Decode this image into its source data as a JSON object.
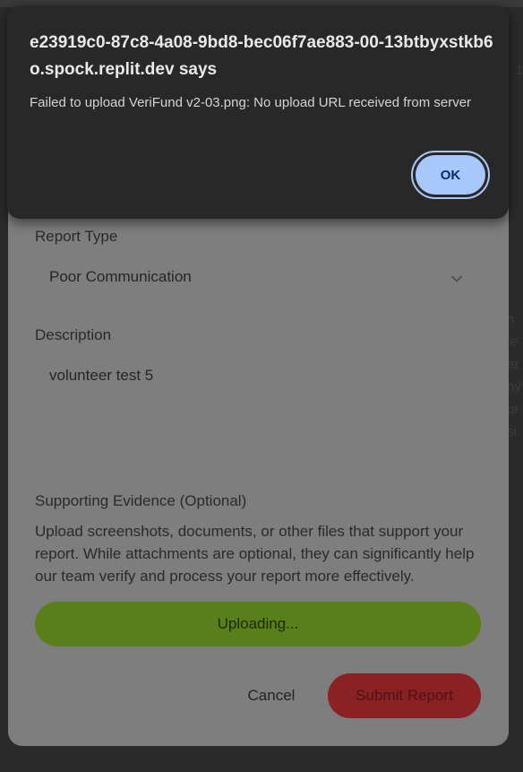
{
  "alert": {
    "title": "e23919c0-87c8-4a08-9bd8-bec06f7ae883-00-13btbyxstkb6o.spock.replit.dev says",
    "message": "Failed to upload VeriFund v2-03.png: No upload URL received from server",
    "ok_label": "OK"
  },
  "form": {
    "report_type_label": "Report Type",
    "report_type_value": "Poor Communication",
    "description_label": "Description",
    "description_value": "volunteer test 5",
    "evidence_label": "Supporting Evidence (Optional)",
    "evidence_help": "Upload screenshots, documents, or other files that support your report. While attachments are optional, they can significantly help our team verify and process your report more effectively.",
    "upload_label": "Uploading...",
    "cancel_label": "Cancel",
    "submit_label": "Submit Report"
  },
  "colors": {
    "upload_button": "#587f1a",
    "submit_button": "#8a2125",
    "ok_button": "#a8c7fa"
  },
  "icons": {
    "select_chevron": "chevron-down-icon"
  }
}
